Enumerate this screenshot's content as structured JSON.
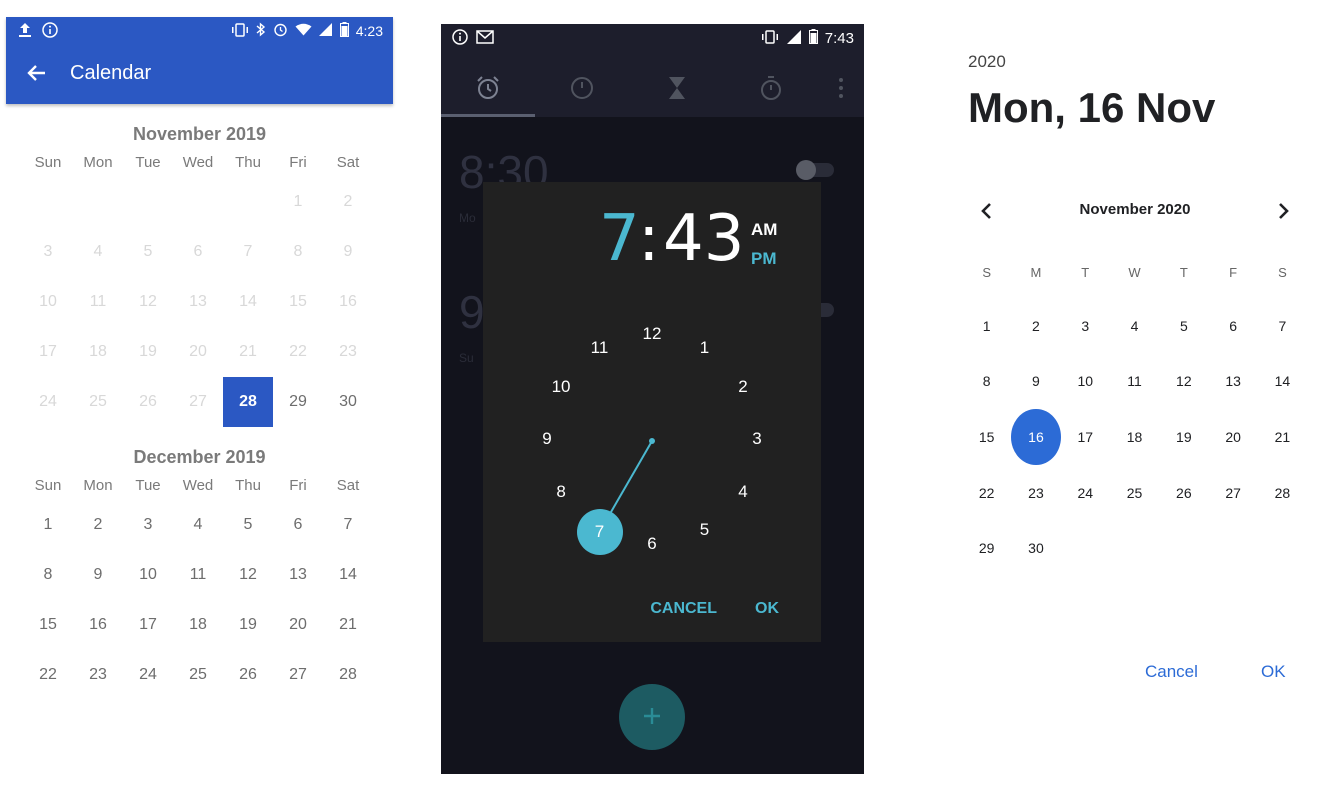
{
  "calendar_app": {
    "status_bar": {
      "time": "4:23"
    },
    "title": "Calendar",
    "months": [
      {
        "title": "November 2019",
        "weekdays": [
          "Sun",
          "Mon",
          "Tue",
          "Wed",
          "Thu",
          "Fri",
          "Sat"
        ],
        "rows": [
          [
            "",
            "",
            "",
            "",
            "",
            "1",
            "2"
          ],
          [
            "3",
            "4",
            "5",
            "6",
            "7",
            "8",
            "9"
          ],
          [
            "10",
            "11",
            "12",
            "13",
            "14",
            "15",
            "16"
          ],
          [
            "17",
            "18",
            "19",
            "20",
            "21",
            "22",
            "23"
          ],
          [
            "24",
            "25",
            "26",
            "27",
            "28",
            "29",
            "30"
          ]
        ],
        "selected": "28"
      },
      {
        "title": "December 2019",
        "weekdays": [
          "Sun",
          "Mon",
          "Tue",
          "Wed",
          "Thu",
          "Fri",
          "Sat"
        ],
        "rows": [
          [
            "1",
            "2",
            "3",
            "4",
            "5",
            "6",
            "7"
          ],
          [
            "8",
            "9",
            "10",
            "11",
            "12",
            "13",
            "14"
          ],
          [
            "15",
            "16",
            "17",
            "18",
            "19",
            "20",
            "21"
          ],
          [
            "22",
            "23",
            "24",
            "25",
            "26",
            "27",
            "28"
          ]
        ]
      }
    ]
  },
  "clock_app": {
    "status_bar": {
      "time": "7:43"
    },
    "tabs": [
      "alarm-icon",
      "clock-icon",
      "timer-icon",
      "stopwatch-icon",
      "more-icon"
    ],
    "background": {
      "alarm1_time": "8:30",
      "alarm1_sub": "Mo",
      "alarm2_time": "9",
      "alarm2_sub": "Su"
    },
    "dialog": {
      "hour": "7",
      "colon": ":",
      "minute": "43",
      "am": "AM",
      "pm": "PM",
      "clock_numbers": [
        "12",
        "1",
        "2",
        "3",
        "4",
        "5",
        "6",
        "7",
        "8",
        "9",
        "10",
        "11"
      ],
      "selected_hour": "7",
      "cancel": "CANCEL",
      "ok": "OK"
    },
    "fab_icon": "plus-icon"
  },
  "date_picker": {
    "year": "2020",
    "selected_date": "Mon, 16 Nov",
    "month_label": "November 2020",
    "weekdays": [
      "S",
      "M",
      "T",
      "W",
      "T",
      "F",
      "S"
    ],
    "rows": [
      [
        "1",
        "2",
        "3",
        "4",
        "5",
        "6",
        "7"
      ],
      [
        "8",
        "9",
        "10",
        "11",
        "12",
        "13",
        "14"
      ],
      [
        "15",
        "16",
        "17",
        "18",
        "19",
        "20",
        "21"
      ],
      [
        "22",
        "23",
        "24",
        "25",
        "26",
        "27",
        "28"
      ],
      [
        "29",
        "30",
        "",
        "",
        "",
        "",
        ""
      ]
    ],
    "selected": "16",
    "cancel": "Cancel",
    "ok": "OK"
  }
}
